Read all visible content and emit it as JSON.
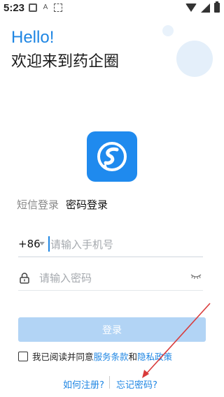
{
  "status_bar": {
    "time": "5:23",
    "icons": [
      "sim-card-icon",
      "a-notification-icon",
      "grid-notification-icon",
      "wifi-icon",
      "signal-icon",
      "battery-icon"
    ]
  },
  "header": {
    "greeting": "Hello!",
    "welcome": "欢迎来到药企圈"
  },
  "tabs": {
    "sms_login": "短信登录",
    "password_login": "密码登录",
    "active": "password_login"
  },
  "phone": {
    "country_code": "+86",
    "placeholder": "请输入手机号"
  },
  "password": {
    "placeholder": "请输入密码"
  },
  "login_button": {
    "label": "登录"
  },
  "agreement": {
    "prefix": "我已阅读并同意",
    "terms": "服务条款",
    "and": "和",
    "privacy": "隐私政策"
  },
  "footer": {
    "register": "如何注册?",
    "forgot": "忘记密码?"
  },
  "colors": {
    "accent": "#1f86e3",
    "button_disabled": "#b2d4f5",
    "logo_bg": "#1f8aee",
    "annotation_arrow": "#d93b3b"
  }
}
